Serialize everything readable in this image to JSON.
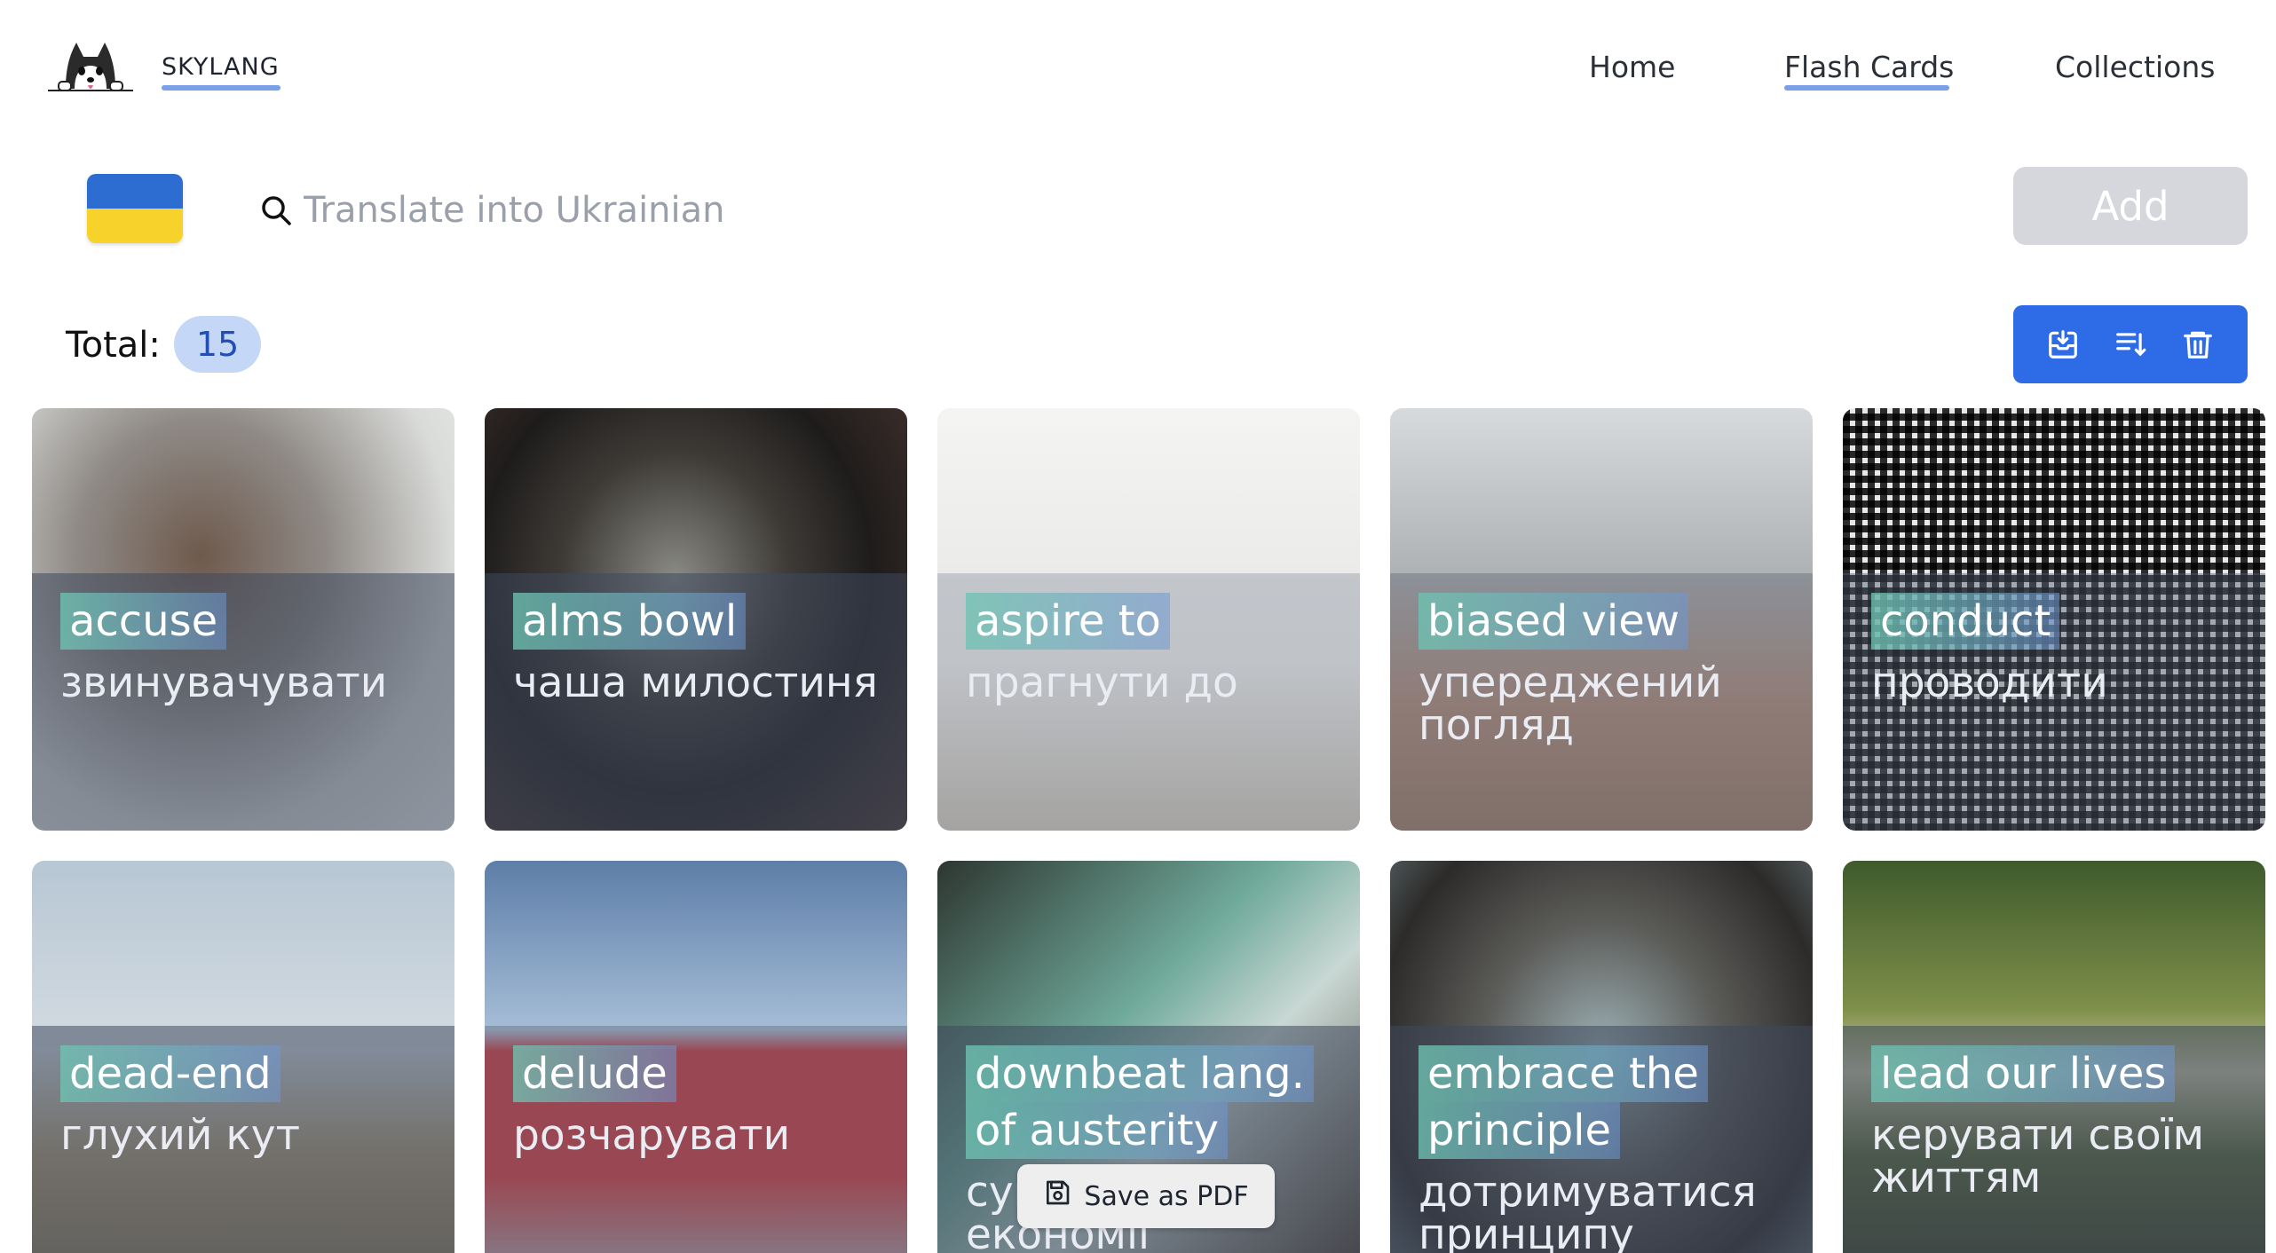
{
  "brand": {
    "name": "SKYLANG",
    "logo_icon": "husky-dog-logo"
  },
  "nav": {
    "home": "Home",
    "flash_cards": "Flash Cards",
    "collections": "Collections",
    "active": "Flash Cards"
  },
  "search": {
    "flag_icon": "ukraine-flag-icon",
    "placeholder": "Translate into Ukrainian",
    "value": ""
  },
  "add_button": {
    "label": "Add"
  },
  "total": {
    "label": "Total:",
    "count": "15"
  },
  "toolbar": {
    "buttons": [
      {
        "icon": "download-icon"
      },
      {
        "icon": "sort-icon"
      },
      {
        "icon": "trash-icon"
      }
    ]
  },
  "cards": [
    {
      "word": "accuse",
      "translation": "звинувачувати",
      "image": "man pointing finger"
    },
    {
      "word": "alms bowl",
      "translation": "чаша милостиня",
      "image": "metal bowl with yellow cloth"
    },
    {
      "word": "aspire to",
      "translation": "прагнути до",
      "image": "person in beanie in fog"
    },
    {
      "word": "biased view",
      "translation": "упереджений погляд",
      "image": "city skyline and terrace"
    },
    {
      "word": "conduct",
      "translation": "проводити",
      "image": "room of QR codes"
    },
    {
      "word": "dead-end",
      "translation": "глухий кут",
      "image": "dead end road sign"
    },
    {
      "word": "delude",
      "translation": "розчарувати",
      "image": "wrong way sign"
    },
    {
      "word": "downbeat lang. of austerity",
      "translation": "сувора мова економії",
      "image": "people reading documents"
    },
    {
      "word": "embrace the principle",
      "translation": "дотримуватися принципу",
      "image": "two people hugging"
    },
    {
      "word": "lead our lives",
      "translation": "керувати своїм життям",
      "image": "forest with stream"
    }
  ],
  "colors": {
    "accent_blue": "#2e6be6",
    "underline": "#7aa0ea",
    "badge_bg": "#c4d7f6",
    "add_disabled": "#d5d7dc"
  },
  "pdf_button": {
    "label": "Save as PDF",
    "icon": "save-floppy-icon"
  }
}
